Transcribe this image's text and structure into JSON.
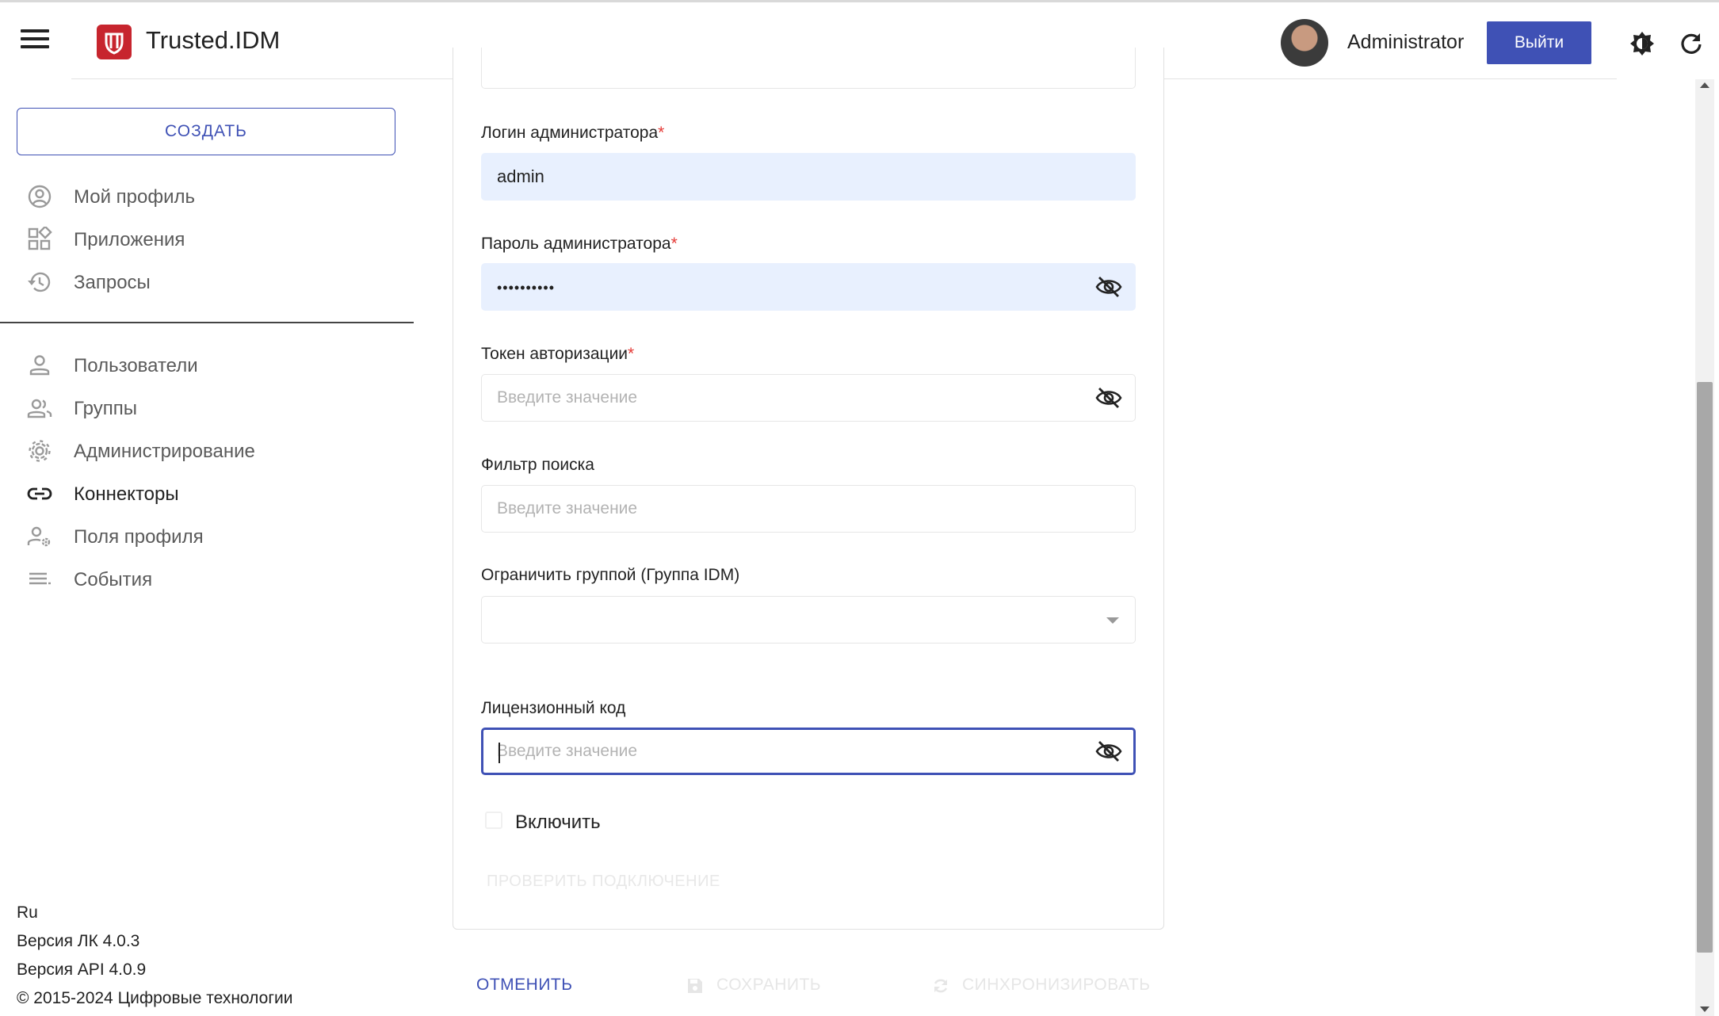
{
  "header": {
    "app_title": "Trusted.IDM",
    "username": "Administrator",
    "logout_label": "Выйти"
  },
  "sidebar": {
    "create_label": "СОЗДАТЬ",
    "items_top": [
      {
        "label": "Мой профиль",
        "icon": "account-circle-icon"
      },
      {
        "label": "Приложения",
        "icon": "apps-grid-icon"
      },
      {
        "label": "Запросы",
        "icon": "history-icon"
      }
    ],
    "items_admin": [
      {
        "label": "Пользователи",
        "icon": "person-icon"
      },
      {
        "label": "Группы",
        "icon": "group-icon"
      },
      {
        "label": "Администрирование",
        "icon": "gear-icon"
      },
      {
        "label": "Коннекторы",
        "icon": "link-icon",
        "active": true
      },
      {
        "label": "Поля профиля",
        "icon": "manage-accounts-icon"
      },
      {
        "label": "События",
        "icon": "list-icon"
      }
    ],
    "footer": {
      "language": "Ru",
      "version_lk": "Версия ЛК 4.0.3",
      "version_api": "Версия API 4.0.9",
      "copyright": "© 2015-2024 Цифровые технологии"
    }
  },
  "form": {
    "admin_login": {
      "label": "Логин администратора",
      "required_mark": "*",
      "value": "admin"
    },
    "admin_password": {
      "label": "Пароль администратора",
      "required_mark": "*",
      "value": "••••••••••"
    },
    "auth_token": {
      "label": "Токен авторизации",
      "required_mark": "*",
      "placeholder": "Введите значение"
    },
    "search_filter": {
      "label": "Фильтр поиска",
      "placeholder": "Введите значение"
    },
    "group_limit": {
      "label": "Ограничить группой (Группа IDM)",
      "value": ""
    },
    "license_code": {
      "label": "Лицензионный код",
      "placeholder": "Введите значение"
    },
    "enable": {
      "label": "Включить",
      "checked": false
    },
    "check_connection_label": "ПРОВЕРИТЬ ПОДКЛЮЧЕНИЕ"
  },
  "actions": {
    "cancel_label": "ОТМЕНИТЬ",
    "save_label": "СОХРАНИТЬ",
    "sync_label": "СИНХРОНИЗИРОВАТЬ"
  },
  "colors": {
    "accent": "#3f51b5",
    "logo": "#c7252e",
    "required": "#e53935",
    "filled_field": "#e8f0fe"
  }
}
